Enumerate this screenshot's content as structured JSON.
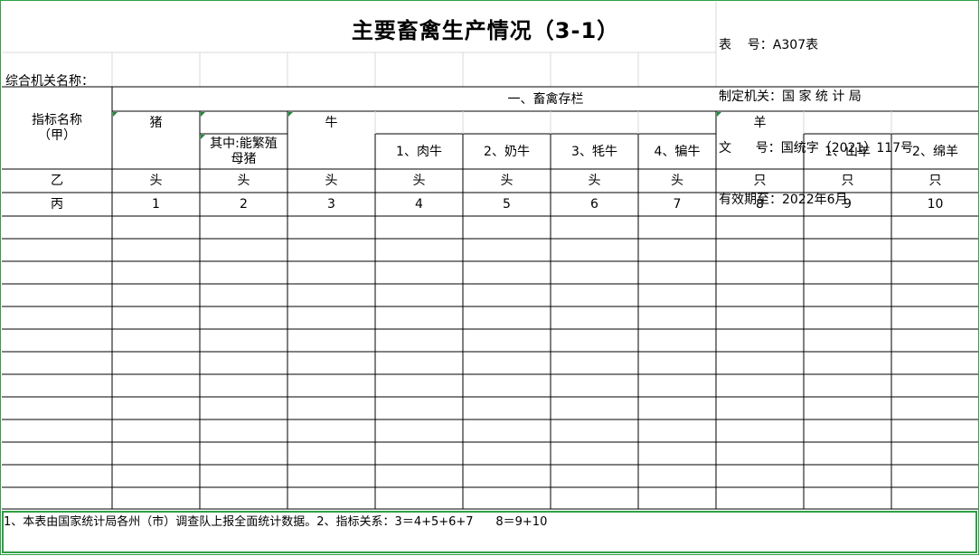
{
  "title": "主要畜禽生产情况（3-1）",
  "meta": {
    "table_no": "表    号：A307表",
    "authority": "制定机关：国 家 统 计 局",
    "doc_no": "文      号：国统字（2021）117号",
    "valid_until": "有效期至：2022年6月"
  },
  "org_label": "综合机关名称：",
  "headers": {
    "indicator": "指标名称",
    "indicator_sub": "（甲）",
    "section": "一、畜禽存栏",
    "pig": "猪",
    "pig_sub_1": "其中:能繁殖",
    "pig_sub_2": "母猪",
    "cattle": "牛",
    "beef": "1、肉牛",
    "dairy": "2、奶牛",
    "yak": "3、牦牛",
    "pian": "4、犏牛",
    "sheep": "羊",
    "goat": "1、山羊",
    "woolsheep": "2、绵羊"
  },
  "row_b": {
    "label": "乙",
    "units": [
      "头",
      "头",
      "头",
      "头",
      "头",
      "头",
      "头",
      "只",
      "只",
      "只"
    ]
  },
  "row_c": {
    "label": "丙",
    "numbers": [
      "1",
      "2",
      "3",
      "4",
      "5",
      "6",
      "7",
      "8",
      "9",
      "10"
    ]
  },
  "footnote": "1、本表由国家统计局各州（市）调查队上报全面统计数据。2、指标关系：3＝4+5+6+7      8＝9+10"
}
